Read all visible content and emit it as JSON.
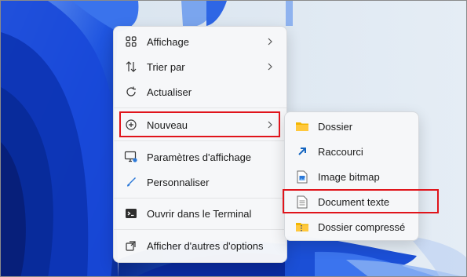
{
  "context_menu": {
    "items": [
      {
        "label": "Affichage",
        "icon": "grid-icon",
        "submenu": true
      },
      {
        "label": "Trier par",
        "icon": "sort-icon",
        "submenu": true
      },
      {
        "label": "Actualiser",
        "icon": "refresh-icon",
        "submenu": false
      },
      {
        "label": "Nouveau",
        "icon": "add-circle-icon",
        "submenu": true
      },
      {
        "label": "Paramètres d'affichage",
        "icon": "display-icon",
        "submenu": false
      },
      {
        "label": "Personnaliser",
        "icon": "brush-icon",
        "submenu": false
      },
      {
        "label": "Ouvrir dans le Terminal",
        "icon": "terminal-icon",
        "submenu": false
      },
      {
        "label": "Afficher d'autres d'options",
        "icon": "share-icon",
        "submenu": false
      }
    ]
  },
  "new_submenu": {
    "items": [
      {
        "label": "Dossier",
        "icon": "folder-icon"
      },
      {
        "label": "Raccourci",
        "icon": "shortcut-icon"
      },
      {
        "label": "Image bitmap",
        "icon": "bitmap-image-icon"
      },
      {
        "label": "Document texte",
        "icon": "text-document-icon"
      },
      {
        "label": "Dossier compressé",
        "icon": "zip-folder-icon"
      }
    ]
  },
  "colors": {
    "highlight_box": "#e0141b",
    "accent": "#0067c0",
    "wallpaper_blue": "#0b3fd0"
  }
}
